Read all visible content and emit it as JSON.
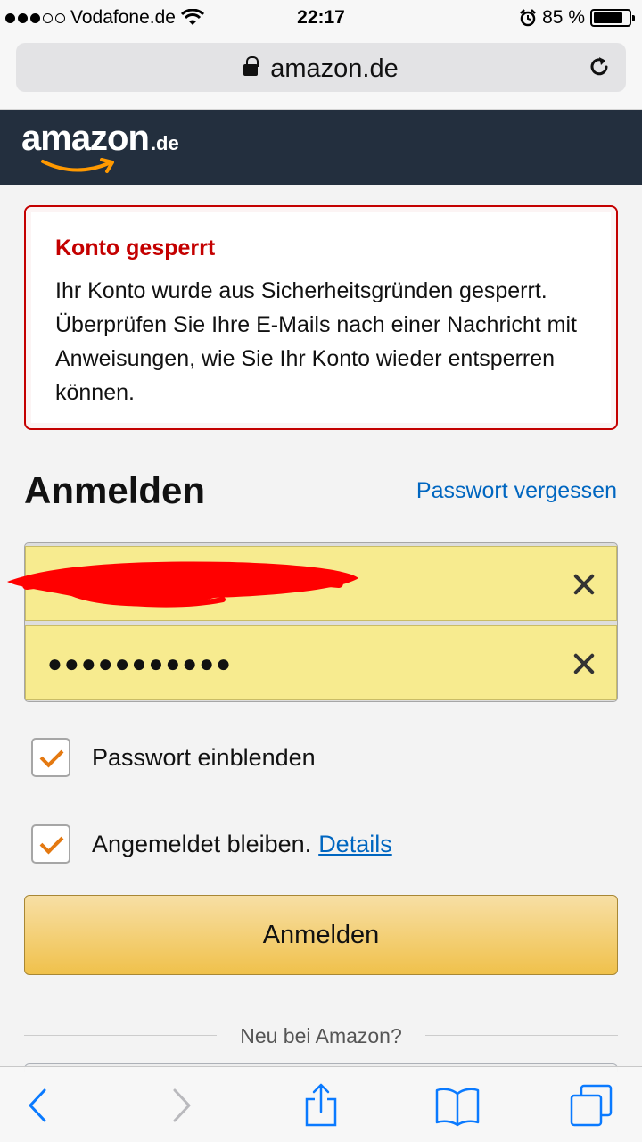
{
  "status_bar": {
    "carrier": "Vodafone.de",
    "time": "22:17",
    "battery": "85 %",
    "battery_level": 0.85
  },
  "browser": {
    "url": "amazon.de"
  },
  "header": {
    "logo_text": "amazon",
    "logo_tld": ".de"
  },
  "alert": {
    "title": "Konto gesperrt",
    "message": "Ihr Konto wurde aus Sicherheitsgründen gesperrt. Überprüfen Sie Ihre E-Mails nach einer Nachricht mit Anweisungen, wie Sie Ihr Konto wieder entsperren können."
  },
  "signin": {
    "heading": "Anmelden",
    "forgot_password": "Passwort vergessen",
    "email_value": "",
    "password_value": "●●●●●●●●●●●",
    "show_password_label": "Passwort einblenden",
    "stay_signed_in_label": "Angemeldet bleiben.",
    "details_link": "Details",
    "submit_label": "Anmelden",
    "new_customer": "Neu bei Amazon?"
  },
  "colors": {
    "header_bg": "#232f3e",
    "alert_red": "#c40000",
    "link_blue": "#0066c0",
    "field_yellow": "#f7eb8f",
    "checkmark_orange": "#e47911",
    "button_gold": "#f0c14b"
  }
}
